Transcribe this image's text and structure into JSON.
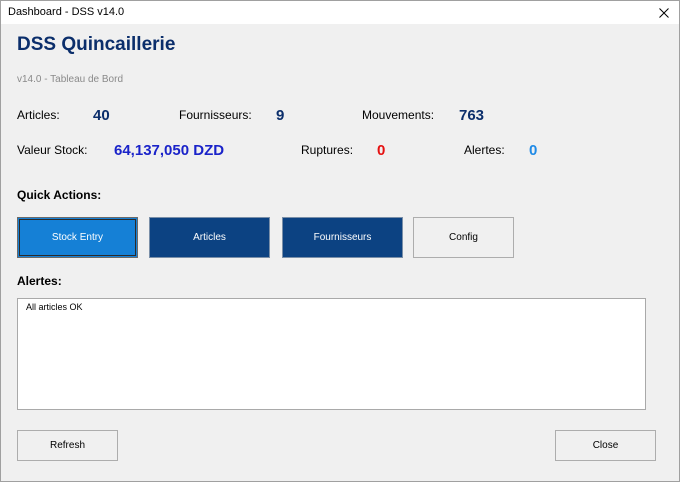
{
  "window": {
    "title": "Dashboard - DSS v14.0"
  },
  "header": {
    "app_title": "DSS Quincaillerie",
    "subtitle": "v14.0 - Tableau de Bord"
  },
  "stats": {
    "articles": {
      "label": "Articles:",
      "value": "40"
    },
    "fournisseurs": {
      "label": "Fournisseurs:",
      "value": "9"
    },
    "mouvements": {
      "label": "Mouvements:",
      "value": "763"
    },
    "valeur_stock": {
      "label": "Valeur Stock:",
      "value": "64,137,050 DZD"
    },
    "ruptures": {
      "label": "Ruptures:",
      "value": "0"
    },
    "alertes": {
      "label": "Alertes:",
      "value": "0"
    }
  },
  "quick_actions": {
    "heading": "Quick Actions:",
    "stock_entry": "Stock Entry",
    "articles": "Articles",
    "fournisseurs": "Fournisseurs",
    "config": "Config"
  },
  "alerts": {
    "heading": "Alertes:",
    "content": "All articles OK"
  },
  "footer": {
    "refresh": "Refresh",
    "close": "Close"
  },
  "colors": {
    "title": "#0b2e6b",
    "value_default": "#0b2e6b",
    "value_stock": "#1a23c9",
    "value_ruptures": "#e51010",
    "value_alertes": "#1f8ae6",
    "button_dark": "#0c4282",
    "button_active": "#1580d6"
  },
  "icons": {
    "close": "close-icon"
  }
}
